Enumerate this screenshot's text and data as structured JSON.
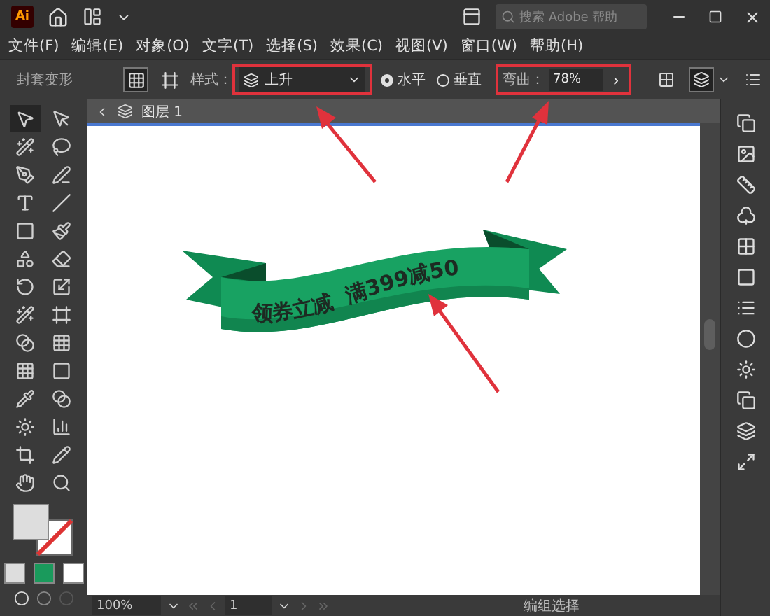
{
  "title_bar": {
    "app_logo": "Ai",
    "search_placeholder": "搜索 Adobe 帮助"
  },
  "menu": [
    "文件(F)",
    "编辑(E)",
    "对象(O)",
    "文字(T)",
    "选择(S)",
    "效果(C)",
    "视图(V)",
    "窗口(W)",
    "帮助(H)"
  ],
  "control_bar": {
    "label": "封套变形",
    "style_label": "样式：",
    "style_value": "上升",
    "orientation": [
      {
        "label": "水平",
        "selected": true
      },
      {
        "label": "垂直",
        "selected": false
      }
    ],
    "bend_label": "弯曲：",
    "bend_value": "78%",
    "next": "›"
  },
  "document_tab": {
    "title": "图层 1"
  },
  "artwork": {
    "text": "领券立减  满399减50"
  },
  "status_bar": {
    "zoom": "100%",
    "page": "1",
    "status": "编组选择"
  }
}
